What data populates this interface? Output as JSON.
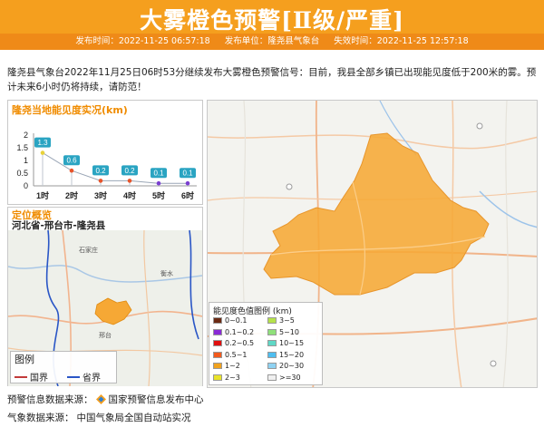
{
  "header": {
    "title": "大雾橙色预警[Ⅱ级/严重]",
    "publish_time": "发布时间：2022-11-25 06:57:18",
    "publisher": "发布单位：隆尧县气象台",
    "expire_time": "失效时间：2022-11-25 12:57:18"
  },
  "description": "隆尧县气象台2022年11月25日06时53分继续发布大雾橙色预警信号：目前，我县全部乡镇已出现能见度低于200米的雾。预计未来6小时仍将持续，请防范！",
  "visibility_panel": {
    "title": "隆尧当地能见度实况(km)",
    "colors": {
      "accent": "#f08c00",
      "label_bg": "#2aa4c2"
    }
  },
  "chart_data": {
    "type": "line",
    "title": "隆尧当地能见度实况(km)",
    "categories": [
      "1时",
      "2时",
      "3时",
      "4时",
      "5时",
      "6时"
    ],
    "values": [
      1.3,
      0.6,
      0.2,
      0.2,
      0.1,
      0.1
    ],
    "value_labels": [
      "1.3",
      "0.6",
      "0.2",
      "0.2",
      "0.1",
      "0.1"
    ],
    "point_colors": [
      "#e8d23a",
      "#e8542a",
      "#e8542a",
      "#e8542a",
      "#7a3fd0",
      "#7a3fd0"
    ],
    "yticks": [
      "2",
      "1.5",
      "1",
      "0.5",
      "0"
    ],
    "ylim": [
      0,
      2
    ],
    "grid": false
  },
  "location_panel": {
    "title": "定位概览",
    "region": "河北省-邢台市-隆尧县",
    "legend_title": "图例",
    "legend_country": "国界",
    "legend_province": "省界",
    "city_label_1": "石家庄",
    "city_label_2": "衡水",
    "city_label_3": "邢台"
  },
  "visibility_legend": {
    "title": "能见度色值图例 (km)",
    "items": [
      {
        "label": "0~0.1",
        "color": "#6b2a14"
      },
      {
        "label": "3~5",
        "color": "#b5e24a"
      },
      {
        "label": "0.1~0.2",
        "color": "#8a2ad6"
      },
      {
        "label": "5~10",
        "color": "#8fe07a"
      },
      {
        "label": "0.2~0.5",
        "color": "#e01010"
      },
      {
        "label": "10~15",
        "color": "#5fd8c6"
      },
      {
        "label": "0.5~1",
        "color": "#f25a1d"
      },
      {
        "label": "15~20",
        "color": "#4fbef0"
      },
      {
        "label": "1~2",
        "color": "#f1a21e"
      },
      {
        "label": "20~30",
        "color": "#8fd2f2"
      },
      {
        "label": "2~3",
        "color": "#e9e32a"
      },
      {
        "label": ">=30",
        "color": "#f0f0f0"
      }
    ]
  },
  "footer": {
    "warning_source_label": "预警信息数据来源：",
    "warning_source": "国家预警信息发布中心",
    "weather_source_label": "气象数据来源：",
    "weather_source": "中国气象局全国自动站实况"
  },
  "colors": {
    "header_bg": "#f59f1e",
    "meta_bg": "#ef8a18",
    "fog_area": "#f6a835"
  }
}
